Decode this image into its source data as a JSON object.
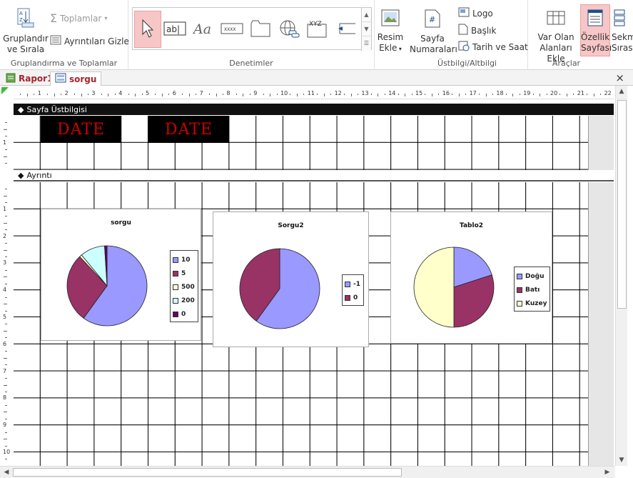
{
  "ribbon": {
    "groups": {
      "grouping": {
        "label": "Gruplandırma ve Toplamlar",
        "group_sort_line1": "Gruplandır",
        "group_sort_line2": "ve Sırala",
        "totals": "Toplamlar",
        "hide_details": "Ayrıntıları Gizle"
      },
      "controls": {
        "label": "Denetimler"
      },
      "image": {
        "insert_image_line1": "Resim",
        "insert_image_line2": "Ekle"
      },
      "header_footer": {
        "label": "Üstbilgi/Altbilgi",
        "page_numbers_line1": "Sayfa",
        "page_numbers_line2": "Numaraları",
        "logo": "Logo",
        "title": "Başlık",
        "date_time": "Tarih ve Saat"
      },
      "tools": {
        "label": "Araçlar",
        "add_fields_line1": "Var Olan",
        "add_fields_line2": "Alanları Ekle",
        "property_sheet_line1": "Özellik",
        "property_sheet_line2": "Sayfası",
        "tab_order_line1": "Sekm",
        "tab_order_line2": "Sıras"
      }
    }
  },
  "tabs": [
    {
      "label": "Rapor1"
    },
    {
      "label": "sorgu"
    }
  ],
  "close_glyph": "×",
  "ruler": {
    "h_numbers": [
      "1",
      "2",
      "3",
      "4",
      "5",
      "6",
      "7",
      "8",
      "9",
      "10",
      "11",
      "12",
      "13",
      "14",
      "15",
      "16",
      "17",
      "18",
      "19",
      "20",
      "21",
      "22"
    ],
    "v_numbers_header": [
      "1"
    ],
    "v_numbers_detail": [
      "1",
      "2",
      "3",
      "4",
      "5",
      "6",
      "7",
      "8",
      "9",
      "10"
    ]
  },
  "sections": {
    "page_header": "Sayfa Üstbilgisi",
    "detail": "Ayrıntı"
  },
  "date_fields": [
    "DATE",
    "DATE"
  ],
  "colors": {
    "accent_red": "#a4262c",
    "pie_blue": "#9999ff",
    "pie_maroon": "#993366",
    "pie_cream": "#ffffcc",
    "pie_cyan": "#ccffff",
    "pie_purple": "#660066"
  },
  "chart_data": [
    {
      "type": "pie",
      "title": "sorgu",
      "categories": [
        "10",
        "5",
        "500",
        "200",
        "0"
      ],
      "values": [
        60,
        28,
        1,
        10,
        1
      ],
      "colors": [
        "#9999ff",
        "#993366",
        "#ffffcc",
        "#ccffff",
        "#660066"
      ]
    },
    {
      "type": "pie",
      "title": "Sorgu2",
      "categories": [
        "-1",
        "0"
      ],
      "values": [
        60,
        40
      ],
      "colors": [
        "#9999ff",
        "#993366"
      ]
    },
    {
      "type": "pie",
      "title": "Tablo2",
      "categories": [
        "Doğu",
        "Batı",
        "Kuzey"
      ],
      "values": [
        20,
        30,
        50
      ],
      "colors": [
        "#9999ff",
        "#993366",
        "#ffffcc"
      ]
    }
  ]
}
